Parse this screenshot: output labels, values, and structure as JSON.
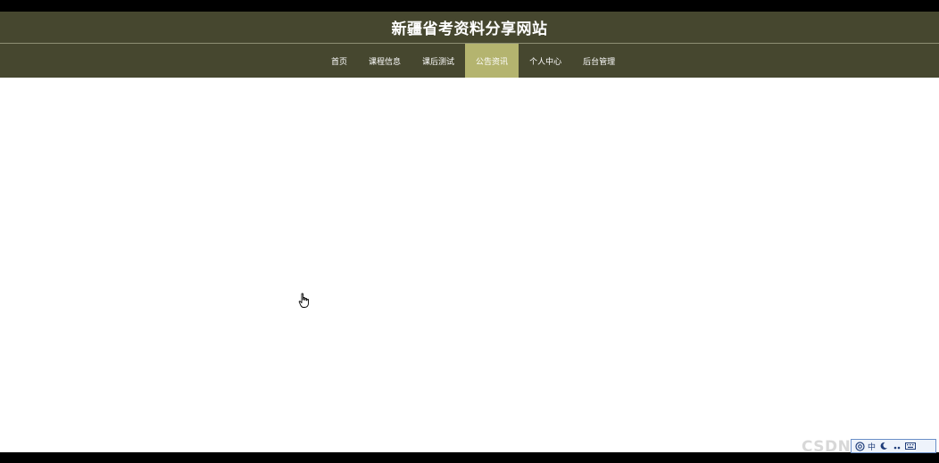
{
  "site": {
    "title": "新疆省考资料分享网站"
  },
  "nav": {
    "items": [
      {
        "label": "首页",
        "active": false
      },
      {
        "label": "课程信息",
        "active": false
      },
      {
        "label": "课后测试",
        "active": false
      },
      {
        "label": "公告资讯",
        "active": true
      },
      {
        "label": "个人中心",
        "active": false
      },
      {
        "label": "后台管理",
        "active": false
      }
    ]
  },
  "overlay": {
    "watermark": "CSDN",
    "ime_mode_label": "中"
  },
  "colors": {
    "header_bg": "#46472f",
    "nav_active_bg": "#b4b46f",
    "content_bg": "#ffffff",
    "text_light": "#ffffff"
  },
  "icons": [
    "hand-cursor-icon",
    "at-sign-icon",
    "moon-icon",
    "punctuation-icon",
    "soft-keyboard-icon"
  ]
}
